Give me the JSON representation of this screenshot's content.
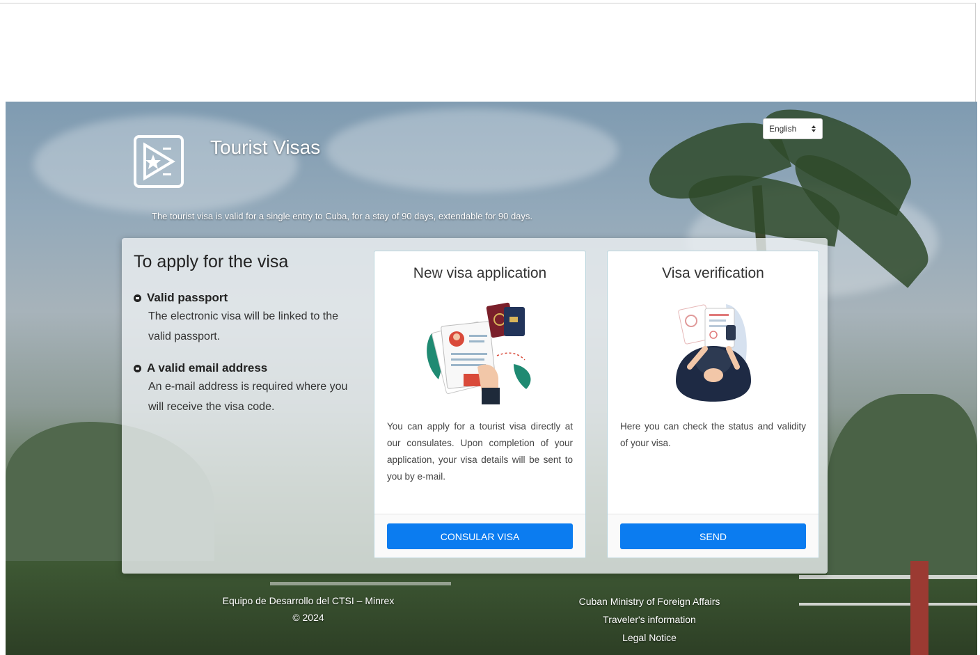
{
  "header": {
    "site_title": "Tourist Visas",
    "tagline": "The tourist visa is valid for a single entry to Cuba, for a stay of 90 days, extendable for 90 days.",
    "language": {
      "selected": "English",
      "icon": "select-arrows-icon"
    }
  },
  "requirements": {
    "title": "To apply for the visa",
    "items": [
      {
        "heading": "Valid passport",
        "text": "The electronic visa will be linked to the valid passport.",
        "icon": "bullet-circle-icon"
      },
      {
        "heading": "A valid email address",
        "text": "An e-mail address is required where you will receive the visa code.",
        "icon": "bullet-circle-icon"
      }
    ]
  },
  "cards": [
    {
      "title": "New visa application",
      "description": "You can apply for a tourist visa directly at our consulates. Upon completion of your application, your visa details will be sent to you by e-mail.",
      "button_label": "CONSULAR VISA",
      "illustration": "passport-application-illustration"
    },
    {
      "title": "Visa verification",
      "description": "Here you can check the status and validity of your visa.",
      "button_label": "SEND",
      "illustration": "document-check-illustration"
    }
  ],
  "footer": {
    "left_line1": "Equipo de Desarrollo del CTSI – Minrex",
    "left_line2": "© 2024",
    "right_links": [
      "Cuban Ministry of Foreign Affairs",
      "Traveler's information",
      "Legal Notice"
    ]
  },
  "colors": {
    "primary_button": "#0b7cf0",
    "card_border": "#b9d4dc",
    "panel_bg": "#ecf0f3"
  }
}
